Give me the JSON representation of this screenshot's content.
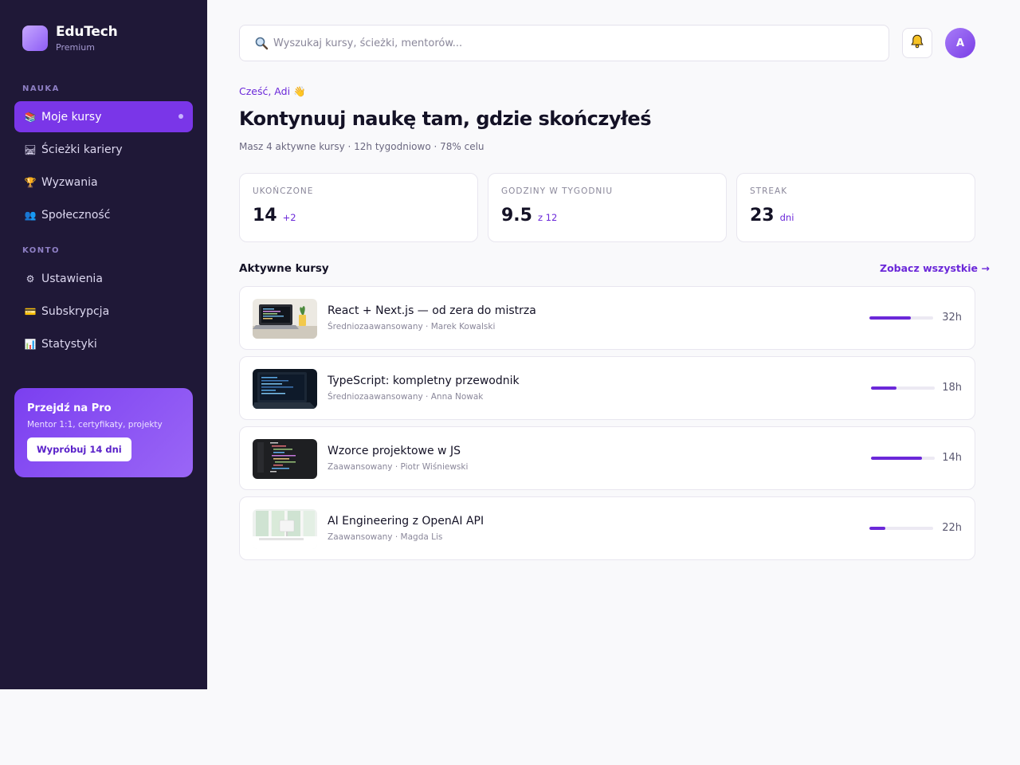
{
  "brand": {
    "name": "EduTech",
    "tier": "Premium"
  },
  "sidebar": {
    "sections": [
      {
        "label": "NAUKA",
        "items": [
          {
            "icon": "books-icon",
            "glyph": "📚",
            "label": "Moje kursy",
            "active": true
          },
          {
            "icon": "railway-icon",
            "glyph": "🛤",
            "label": "Ścieżki kariery",
            "active": false
          },
          {
            "icon": "trophy-icon",
            "glyph": "🏆",
            "label": "Wyzwania",
            "active": false
          },
          {
            "icon": "people-icon",
            "glyph": "👥",
            "label": "Społeczność",
            "active": false
          }
        ]
      },
      {
        "label": "KONTO",
        "items": [
          {
            "icon": "gear-icon",
            "glyph": "⚙",
            "label": "Ustawienia",
            "active": false
          },
          {
            "icon": "credit-card-icon",
            "glyph": "💳",
            "label": "Subskrypcja",
            "active": false
          },
          {
            "icon": "bar-chart-icon",
            "glyph": "📊",
            "label": "Statystyki",
            "active": false
          }
        ]
      }
    ],
    "promo": {
      "title": "Przejdź na Pro",
      "subtitle": "Mentor 1:1, certyfikaty, projekty",
      "button": "Wypróbuj 14 dni"
    }
  },
  "header": {
    "search_placeholder": "Wyszukaj kursy, ścieżki, mentorów...",
    "avatar_initial": "A"
  },
  "hero": {
    "greeting": "Cześć, Adi 👋",
    "title": "Kontynuuj naukę tam, gdzie skończyłeś",
    "subtitle": "Masz 4 aktywne kursy · 12h tygodniowo · 78% celu"
  },
  "stats": [
    {
      "label": "UKOŃCZONE",
      "value": "14",
      "suffix": "+2"
    },
    {
      "label": "GODZINY W TYGODNIU",
      "value": "9.5",
      "suffix": "z 12"
    },
    {
      "label": "STREAK",
      "value": "23",
      "suffix": "dni"
    }
  ],
  "courses_section": {
    "title": "Aktywne kursy",
    "see_all": "Zobacz wszystkie →"
  },
  "courses": [
    {
      "title": "React + Next.js — od zera do mistrza",
      "meta": "Średniozaawansowany · Marek Kowalski",
      "progress": 0.65,
      "hours": "32h",
      "thumb": "laptop-desk"
    },
    {
      "title": "TypeScript: kompletny przewodnik",
      "meta": "Średniozaawansowany · Anna Nowak",
      "progress": 0.4,
      "hours": "18h",
      "thumb": "laptop-dark"
    },
    {
      "title": "Wzorce projektowe w JS",
      "meta": "Zaawansowany · Piotr Wiśniewski",
      "progress": 0.8,
      "hours": "14h",
      "thumb": "code-screen"
    },
    {
      "title": "AI Engineering z OpenAI API",
      "meta": "Zaawansowany · Magda Lis",
      "progress": 0.25,
      "hours": "22h",
      "thumb": "office-window"
    }
  ],
  "colors": {
    "accent": "#6b28d9",
    "sidebar_bg": "#1f1837",
    "active_item": "#7a36e8"
  }
}
